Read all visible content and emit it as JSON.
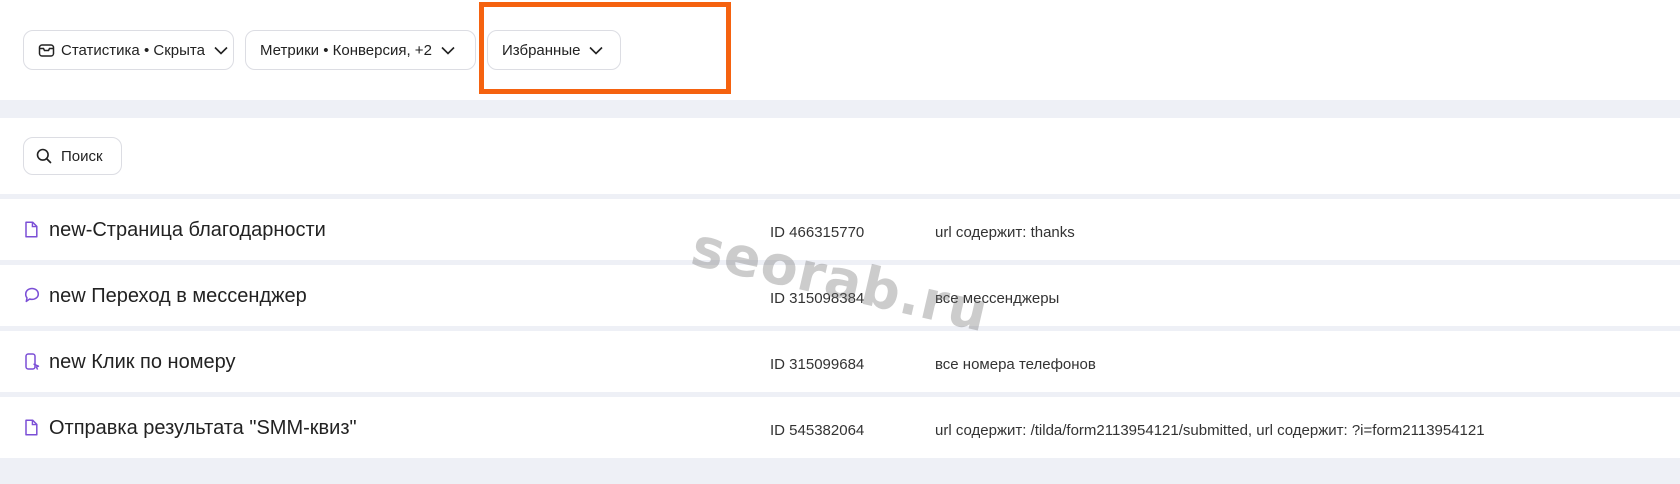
{
  "filters": {
    "stats_label": "Статистика • Скрыта",
    "metrics_label": "Метрики • Конверсия, +2",
    "favorites_label": "Избранные"
  },
  "search": {
    "label": "Поиск"
  },
  "goals": [
    {
      "icon": "page-icon",
      "name": "new-Страница благодарности",
      "id": "ID 466315770",
      "condition": "url содержит: thanks"
    },
    {
      "icon": "messenger-icon",
      "name": "new Переход в мессенджер",
      "id": "ID 315098384",
      "condition": "все мессенджеры"
    },
    {
      "icon": "phone-click-icon",
      "name": "new Клик по номеру",
      "id": "ID 315099684",
      "condition": "все номера телефонов"
    },
    {
      "icon": "page-icon",
      "name": "Отправка результата \"SMM-квиз\"",
      "id": "ID 545382064",
      "condition": "url содержит: /tilda/form2113954121/submitted, url содержит: ?i=form2113954121"
    }
  ],
  "watermark": "seorab.ru",
  "colors": {
    "highlight": "#f5620f",
    "icon_accent": "#7b4fd6",
    "background": "#eef0f6"
  }
}
